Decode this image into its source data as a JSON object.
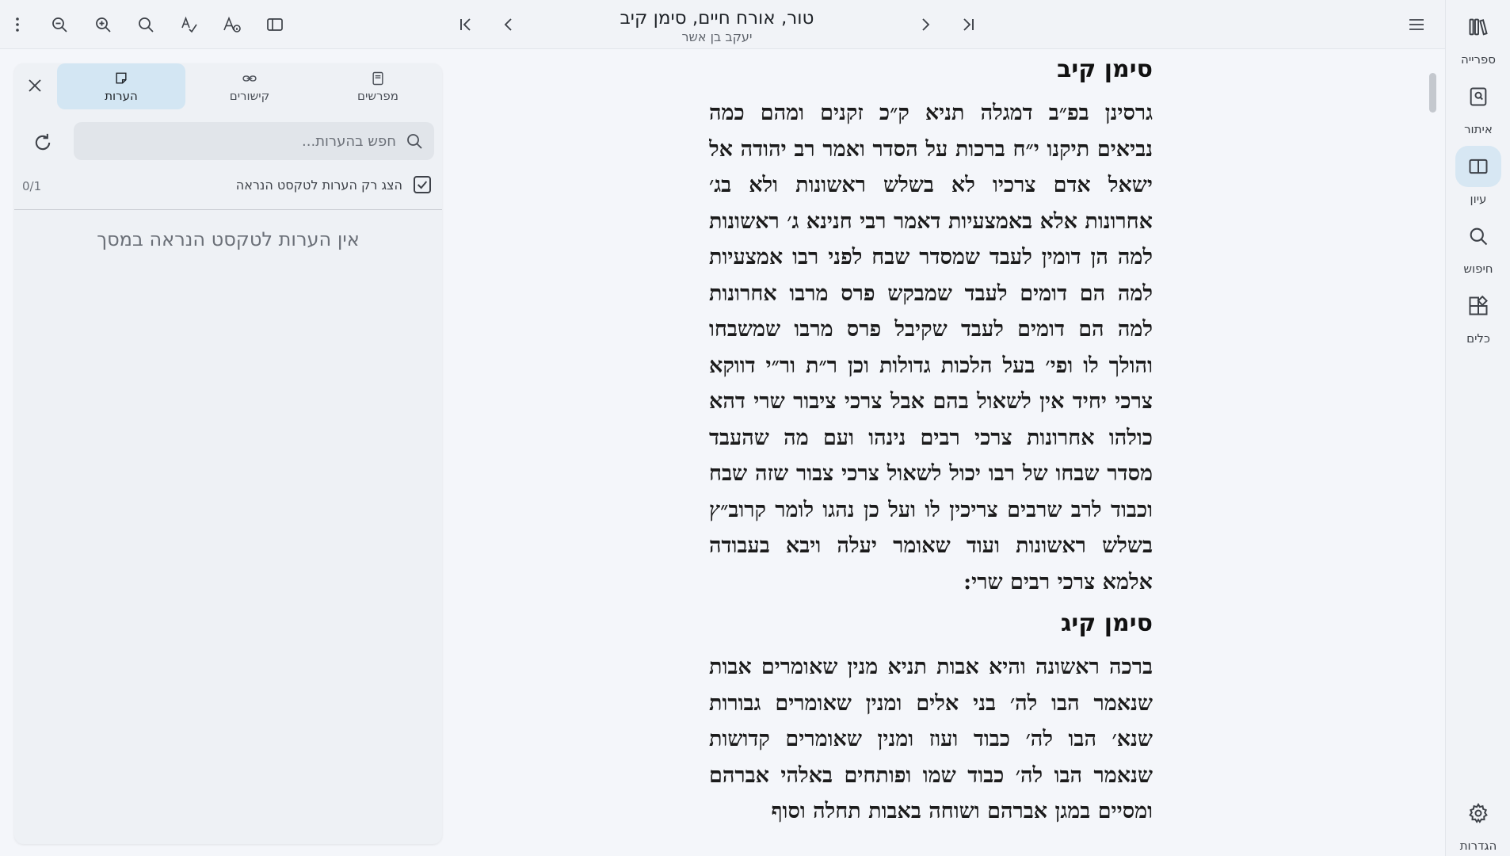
{
  "header": {
    "title": "טור, אורח חיים, סימן קיב",
    "subtitle": "יעקב בן אשר"
  },
  "toolbar_icons": {
    "more": "more-vertical-icon",
    "zoom_out": "zoom-out-icon",
    "zoom_in": "zoom-in-icon",
    "search": "search-icon",
    "text_style": "spell-check-icon",
    "font": "font-info-icon",
    "sidebar": "sidebar-toggle-icon",
    "first": "skip-first-icon",
    "prev": "chevron-left-icon",
    "next": "chevron-right-icon",
    "last": "skip-last-icon",
    "menu": "hamburger-menu-icon"
  },
  "rail": {
    "items": [
      {
        "label": "ספרייה",
        "icon": "library-icon"
      },
      {
        "label": "איתור",
        "icon": "locate-book-icon"
      },
      {
        "label": "עיון",
        "icon": "book-open-icon",
        "active": true
      },
      {
        "label": "חיפוש",
        "icon": "search-icon"
      },
      {
        "label": "כלים",
        "icon": "tools-icon"
      }
    ],
    "settings_label": "הגדרות"
  },
  "panel": {
    "tabs": [
      {
        "label": "מפרשים",
        "icon": "commentary-book-icon"
      },
      {
        "label": "קישורים",
        "icon": "link-icon"
      },
      {
        "label": "הערות",
        "icon": "note-icon",
        "active": true
      }
    ],
    "search_placeholder": "חפש בהערות...",
    "filter_label": "הצג רק הערות לטקסט הנראה",
    "filter_checked": true,
    "counter": "0/1",
    "empty_message": "אין הערות לטקסט הנראה במסך"
  },
  "reader": {
    "sections": [
      {
        "title": "סימן קיב",
        "text": "גרסינן בפ״ב דמגלה תניא ק״כ זקנים ומהם כמה נביאים תיקנו י״ח ברכות על הסדר ואמר רב יהודה אל ישאל אדם צרכיו לא בשלש ראשונות ולא בג׳ אחרונות אלא באמצעיות דאמר רבי חנינא ג׳ ראשונות למה הן דומין לעבד שמסדר שבח לפני רבו אמצעיות למה הם דומים לעבד שמבקש פרס מרבו אחרונות למה הם דומים לעבד שקיבל פרס מרבו שמשבחו והולך לו ופי׳ בעל הלכות גדולות וכן ר״ת ור״י דווקא צרכי יחיד אין לשאול בהם אבל צרכי ציבור שרי דהא כולהו אחרונות צרכי רבים נינהו ועם מה שהעבד מסדר שבחו של רבו יכול לשאול צרכי צבור שזה שבח וכבוד לרב שרבים צריכין לו ועל כן נהגו לומר קרוב״ץ בשלש ראשונות ועוד שאומר יעלה ויבא בעבודה אלמא צרכי רבים שרי:"
      },
      {
        "title": "סימן קיג",
        "text": "ברכה ראשונה והיא אבות תניא מנין שאומרים אבות שנאמר הבו לה׳ בני אלים ומנין שאומרים גבורות שנא׳ הבו לה׳ כבוד ועוז ומנין שאומרים קדושות שנאמר הבו לה׳ כבוד שמו ופותחים באלהי אברהם ומסיים במגן אברהם ושוחה באבות תחלה וסוף"
      }
    ]
  }
}
